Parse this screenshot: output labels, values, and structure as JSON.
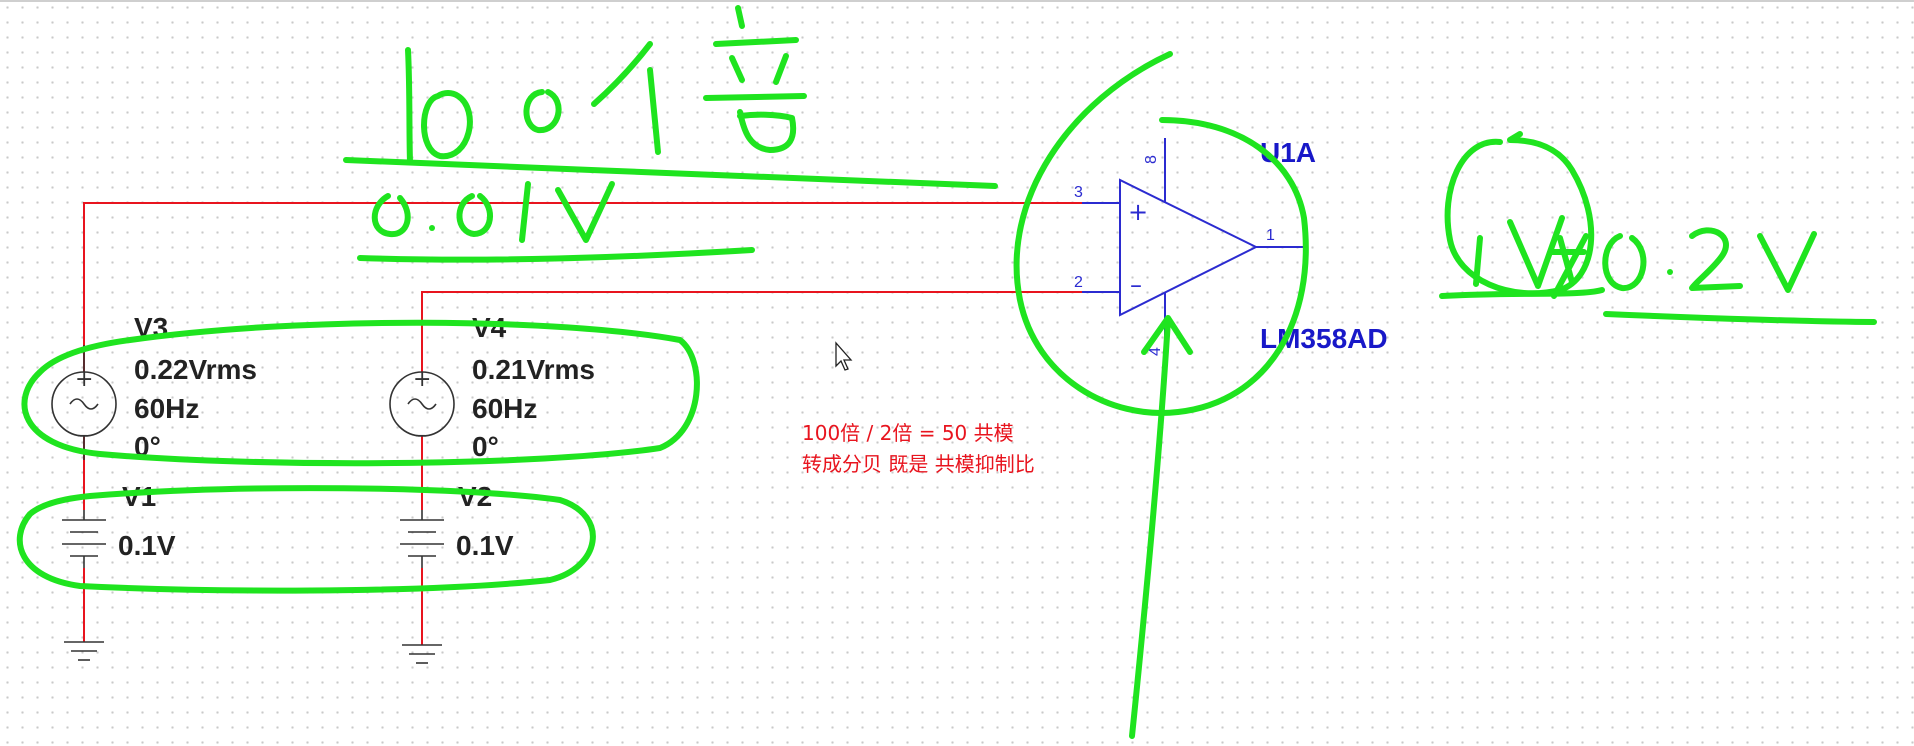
{
  "source_v3": {
    "refdes": "V3",
    "amplitude": "0.22Vrms",
    "frequency": "60Hz",
    "phase": "0°"
  },
  "source_v4": {
    "refdes": "V4",
    "amplitude": "0.21Vrms",
    "frequency": "60Hz",
    "phase": "0°"
  },
  "battery_v1": {
    "refdes": "V1",
    "value": "0.1V"
  },
  "battery_v2": {
    "refdes": "V2",
    "value": "0.1V"
  },
  "opamp": {
    "refdes": "U1A",
    "part": "LM358AD",
    "pin_noninv": "3",
    "pin_inv": "2",
    "pin_out": "1",
    "pin_vcc": "8",
    "pin_gnd": "4"
  },
  "notes": {
    "line1": "100倍 / 2倍 = 50 共模",
    "line2": "转成分贝 既是 共模抑制比"
  },
  "colors": {
    "wire": "#e8141e",
    "component": "#2b2bd0",
    "annotation": "#1fe41f"
  }
}
